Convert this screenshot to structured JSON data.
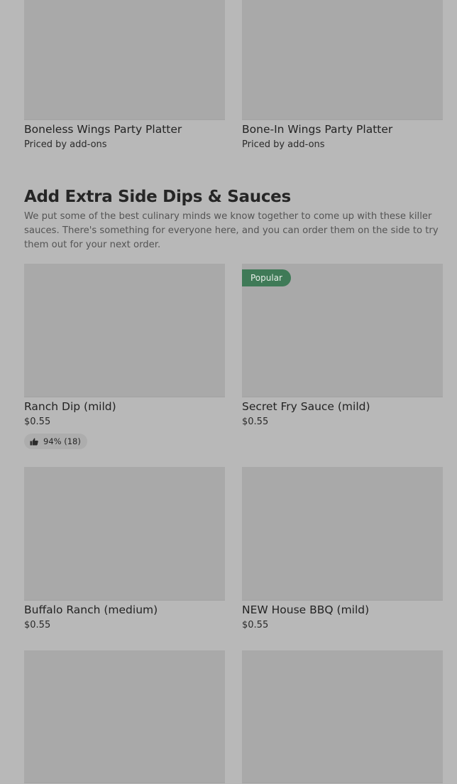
{
  "top_items": [
    {
      "title": "Boneless Wings Party Platter",
      "price": "Priced by add-ons"
    },
    {
      "title": "Bone-In Wings Party Platter",
      "price": "Priced by add-ons"
    }
  ],
  "section": {
    "title": "Add Extra Side Dips & Sauces",
    "description": "We put some of the best culinary minds we know together to come up with these killer sauces. There's something for everyone here, and you can order them on the side to try them out for your next order."
  },
  "items": [
    {
      "title": "Ranch Dip (mild)",
      "price": "$0.55",
      "rating": "94% (18)"
    },
    {
      "title": "Secret Fry Sauce (mild)",
      "price": "$0.55",
      "badge": "Popular"
    },
    {
      "title": "Buffalo Ranch (medium)",
      "price": "$0.55"
    },
    {
      "title": "NEW House BBQ (mild)",
      "price": "$0.55"
    }
  ],
  "icons": {
    "thumbs_up": "thumbs-up-icon"
  },
  "colors": {
    "background": "#b8b8b8",
    "image_placeholder": "#a9a9a9",
    "popular_badge": "#3f7a57"
  }
}
